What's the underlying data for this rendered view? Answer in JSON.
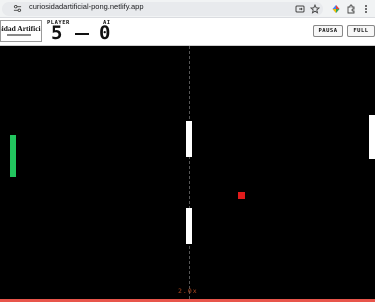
{
  "browser": {
    "url": "curiosidadartificial-pong.netlify.app",
    "icons": [
      "site-info-icon",
      "open-in-app-icon",
      "bookmark-star-icon",
      "extensions-icon",
      "puzzle-icon",
      "browser-menu-icon"
    ]
  },
  "header": {
    "brand": "osidad Artificial",
    "player_label": "PLAYER",
    "player_score": "5",
    "ai_label": "AI",
    "ai_score": "0",
    "pause_label": "PAUSA",
    "full_label": "FULL"
  },
  "game": {
    "speed": "2.0x",
    "colors": {
      "background": "#000000",
      "player_paddle": "#22c55e",
      "obstacle": "#ffffff",
      "ball": "#e01b1b",
      "speed_text": "#b24a22"
    }
  }
}
